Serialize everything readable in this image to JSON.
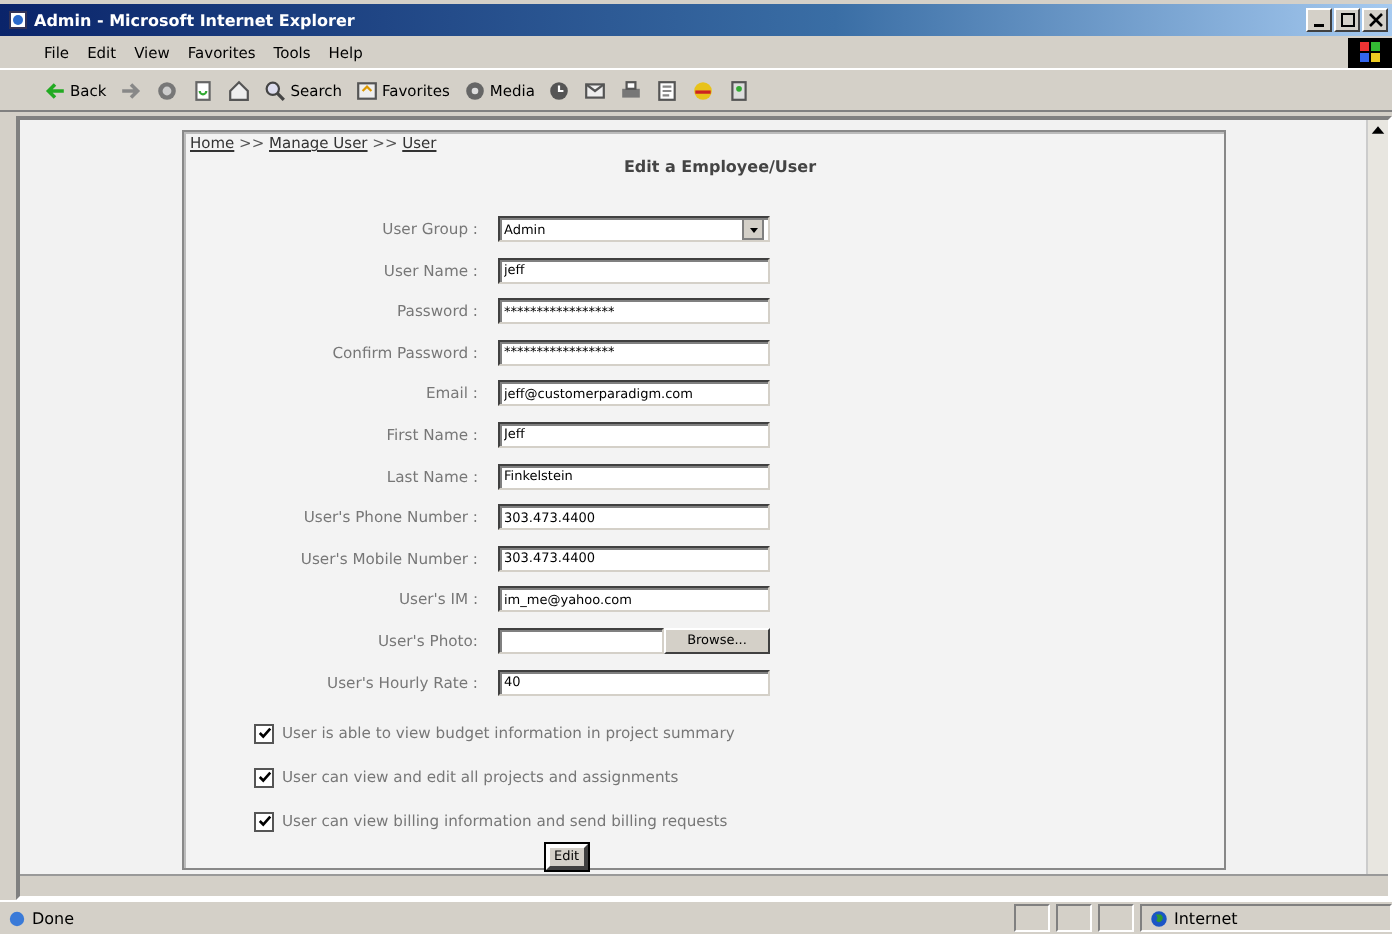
{
  "window": {
    "title": "Admin - Microsoft Internet Explorer"
  },
  "menu": [
    "File",
    "Edit",
    "View",
    "Favorites",
    "Tools",
    "Help"
  ],
  "toolbar": [
    {
      "kind": "back",
      "label": "Back"
    },
    {
      "kind": "forward"
    },
    {
      "kind": "stop"
    },
    {
      "kind": "refresh"
    },
    {
      "kind": "home"
    },
    {
      "kind": "search",
      "label": "Search"
    },
    {
      "kind": "favorites",
      "label": "Favorites"
    },
    {
      "kind": "media",
      "label": "Media"
    },
    {
      "kind": "history"
    },
    {
      "kind": "mail"
    },
    {
      "kind": "print"
    },
    {
      "kind": "edit"
    },
    {
      "kind": "discuss"
    },
    {
      "kind": "messenger"
    }
  ],
  "breadcrumb": [
    {
      "label": "Home"
    },
    {
      "label": "Manage User"
    },
    {
      "label": "User"
    }
  ],
  "breadcrumb_separator": ">>",
  "heading": "Edit a Employee/User",
  "fields": [
    {
      "kind": "select",
      "label": "User Group :",
      "value": "Admin"
    },
    {
      "kind": "text",
      "label": "User Name :",
      "value": "jeff"
    },
    {
      "kind": "text",
      "label": "Password :",
      "value": "*****************"
    },
    {
      "kind": "text",
      "label": "Confirm Password :",
      "value": "*****************"
    },
    {
      "kind": "text",
      "label": "Email :",
      "value": "jeff@customerparadigm.com"
    },
    {
      "kind": "text",
      "label": "First Name :",
      "value": "Jeff"
    },
    {
      "kind": "text",
      "label": "Last Name :",
      "value": "Finkelstein"
    },
    {
      "kind": "text",
      "label": "User's Phone Number :",
      "value": "303.473.4400"
    },
    {
      "kind": "text",
      "label": "User's Mobile Number :",
      "value": "303.473.4400"
    },
    {
      "kind": "text",
      "label": "User's IM :",
      "value": "im_me@yahoo.com"
    },
    {
      "kind": "file",
      "label": "User's Photo:",
      "button": "Browse..."
    },
    {
      "kind": "text",
      "label": "User's Hourly Rate :",
      "value": "40"
    }
  ],
  "permissions": [
    {
      "label": "User is able to view budget information in project summary",
      "checked": true
    },
    {
      "label": "User can view and edit all projects and assignments",
      "checked": true
    },
    {
      "label": "User can view billing information and send billing requests",
      "checked": true
    }
  ],
  "submit": "Edit",
  "status_bar": {
    "text": "Done",
    "zone": "Internet"
  }
}
